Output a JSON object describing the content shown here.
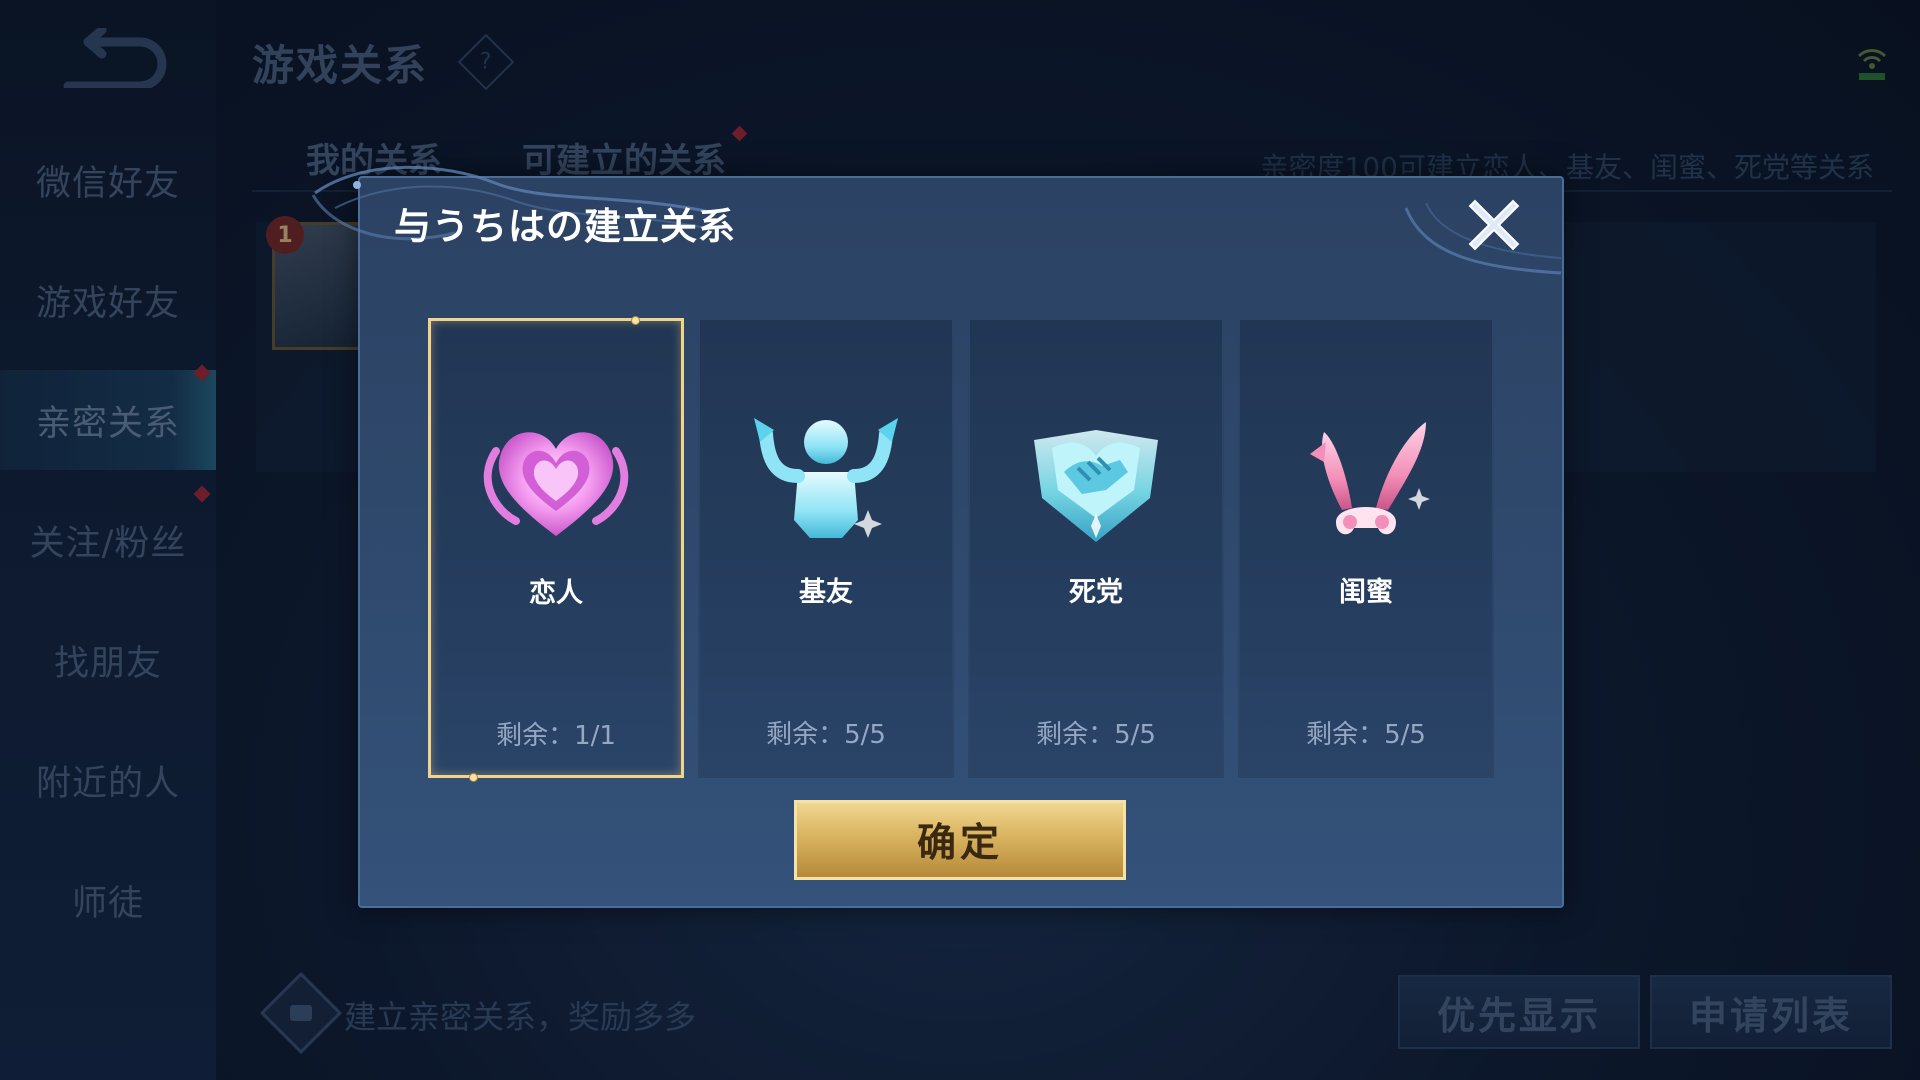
{
  "background": {
    "page_title": "游戏关系",
    "help_icon_glyph": "?",
    "sidebar": {
      "items": [
        {
          "label": "微信好友"
        },
        {
          "label": "游戏好友"
        },
        {
          "label": "亲密关系"
        },
        {
          "label": "关注/粉丝"
        },
        {
          "label": "找朋友"
        },
        {
          "label": "附近的人"
        },
        {
          "label": "师徒"
        }
      ],
      "active_index": 2
    },
    "tabs": [
      {
        "label": "我的关系"
      },
      {
        "label": "可建立的关系"
      }
    ],
    "hint": "亲密度100可建立恋人、基友、闺蜜、死党等关系",
    "friend": {
      "level": "1"
    },
    "bottom_banner": "建立亲密关系，奖励多多",
    "buttons": {
      "priority_display": "优先显示",
      "application_list": "申请列表"
    }
  },
  "modal": {
    "title": "与うちはの建立关系",
    "close_icon": "close-icon",
    "relations": [
      {
        "name": "恋人",
        "remaining": "剩余：1/1",
        "icon": "heart-icon",
        "selected": true
      },
      {
        "name": "基友",
        "remaining": "剩余：5/5",
        "icon": "flexing-buddy-icon",
        "selected": false
      },
      {
        "name": "死党",
        "remaining": "剩余：5/5",
        "icon": "handshake-icon",
        "selected": false
      },
      {
        "name": "闺蜜",
        "remaining": "剩余：5/5",
        "icon": "bunny-ears-icon",
        "selected": false
      }
    ],
    "confirm_label": "确定"
  },
  "colors": {
    "accent_gold": "#f1d48a",
    "modal_bg": "#2f4a6e",
    "lover_pink": "#f08fe8",
    "buddy_cyan": "#7fe3f5",
    "bestie_pink": "#f38fb8"
  }
}
